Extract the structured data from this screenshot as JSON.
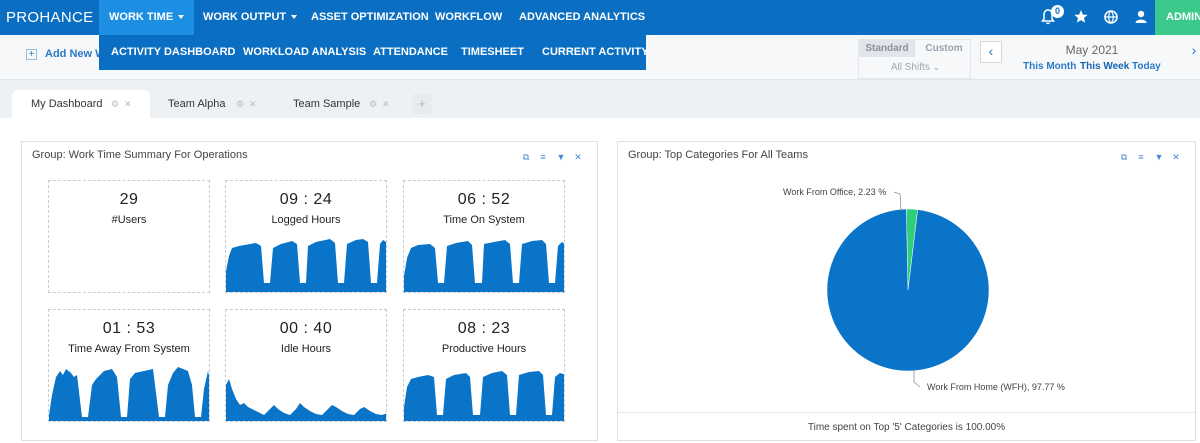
{
  "nav": {
    "logo": "PROHANCE",
    "items": [
      {
        "label": "WORK TIME",
        "dropdown": true
      },
      {
        "label": "WORK OUTPUT",
        "dropdown": true
      },
      {
        "label": "ASSET OPTIMIZATION"
      },
      {
        "label": "WORKFLOW"
      },
      {
        "label": "ADVANCED ANALYTICS"
      }
    ],
    "notification_count": "0",
    "admin_label": "ADMIN",
    "icons": [
      "bell-icon",
      "star-icon",
      "globe-icon",
      "user-icon"
    ]
  },
  "dropdown": {
    "items": [
      "ACTIVITY DASHBOARD",
      "WORKLOAD ANALYSIS",
      "ATTENDANCE",
      "TIMESHEET",
      "CURRENT ACTIVITY"
    ]
  },
  "toolbar": {
    "add_new_label": "Add New W",
    "shift_tabs": [
      "Standard",
      "Custom"
    ],
    "shift_select": "All Shifts",
    "month": "May 2021",
    "date_links": [
      "This Month",
      "This Week",
      "Today"
    ]
  },
  "tabs": [
    {
      "label": "My Dashboard",
      "active": true
    },
    {
      "label": "Team Alpha"
    },
    {
      "label": "Team Sample"
    }
  ],
  "panels": {
    "summary": {
      "title": "Group: Work Time Summary For Operations",
      "tiles": [
        {
          "value": "29",
          "label": "#Users"
        },
        {
          "value": "09 : 24",
          "label": "Logged Hours"
        },
        {
          "value": "06 : 52",
          "label": "Time On System"
        },
        {
          "value": "01 : 53",
          "label": "Time Away From System"
        },
        {
          "value": "00 : 40",
          "label": "Idle Hours"
        },
        {
          "value": "08 : 23",
          "label": "Productive Hours"
        }
      ]
    },
    "categories": {
      "title": "Group: Top Categories For All Teams",
      "footer": "Time spent on Top '5' Categories is 100.00%"
    }
  },
  "chart_data": {
    "type": "pie",
    "labels": [
      "Work From Home (WFH)",
      "Work From Office"
    ],
    "values": [
      97.77,
      2.23
    ],
    "slice_labels": [
      "Work From Home (WFH), 97.77 %",
      "Work From Office, 2.23 %"
    ],
    "colors": [
      "#0a74c9",
      "#2ecf7a"
    ]
  },
  "colors": {
    "nav_bg": "#0a6fc2",
    "nav_active": "#1d8fe3",
    "admin": "#3dc88c",
    "sparkline": "#0a74c9"
  }
}
